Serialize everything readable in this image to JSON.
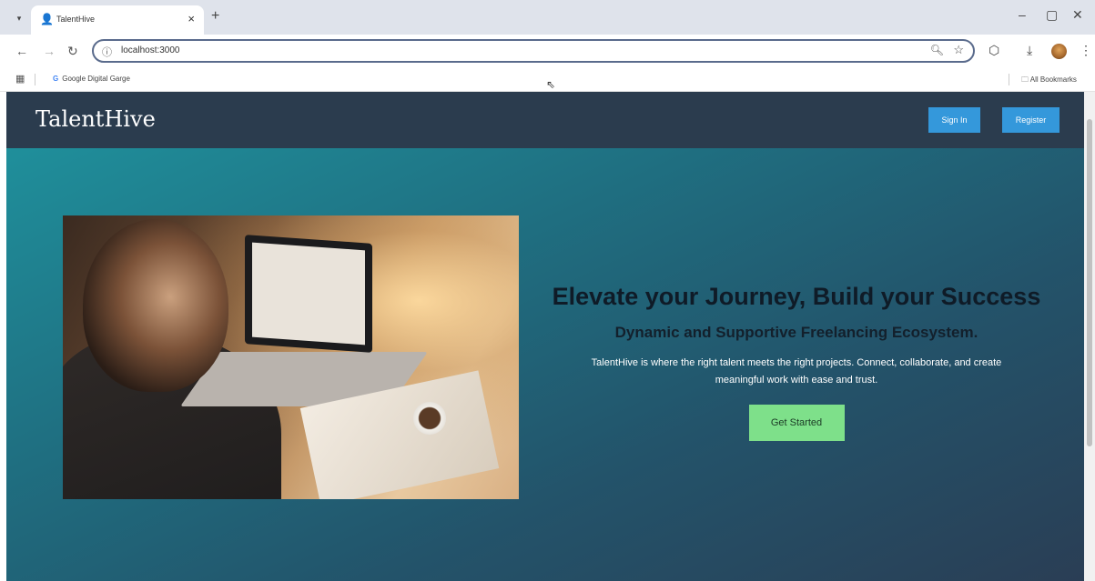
{
  "browser": {
    "tab_title": "TalentHive",
    "tab_close": "×",
    "new_tab": "+",
    "url": "localhost:3000",
    "bookmark_item": "Google Digital Garge",
    "all_bookmarks": "All Bookmarks",
    "icons": {
      "tab_search": "chevron-down-icon",
      "back": "back-arrow-icon",
      "forward": "forward-arrow-icon",
      "reload": "reload-icon",
      "info": "site-info-icon",
      "zoom": "zoom-icon",
      "star": "star-icon",
      "extensions": "extensions-icon",
      "download": "download-icon",
      "menu": "kebab-menu-icon",
      "apps": "apps-grid-icon",
      "folder": "folder-icon"
    }
  },
  "site": {
    "logo": "TalentHive",
    "signin_label": "Sign In",
    "register_label": "Register"
  },
  "hero": {
    "title": "Elevate your Journey, Build your Success",
    "subtitle": "Dynamic and Supportive Freelancing Ecosystem.",
    "description": "TalentHive is where the right talent meets the right projects. Connect, collaborate, and create meaningful work with ease and trust.",
    "cta_label": "Get Started"
  },
  "colors": {
    "header_bg": "#2b3c4e",
    "button_blue": "#3498db",
    "cta_green": "#7ee08a",
    "hero_gradient_start": "#1f8f9b",
    "hero_gradient_end": "#2a3e55"
  }
}
